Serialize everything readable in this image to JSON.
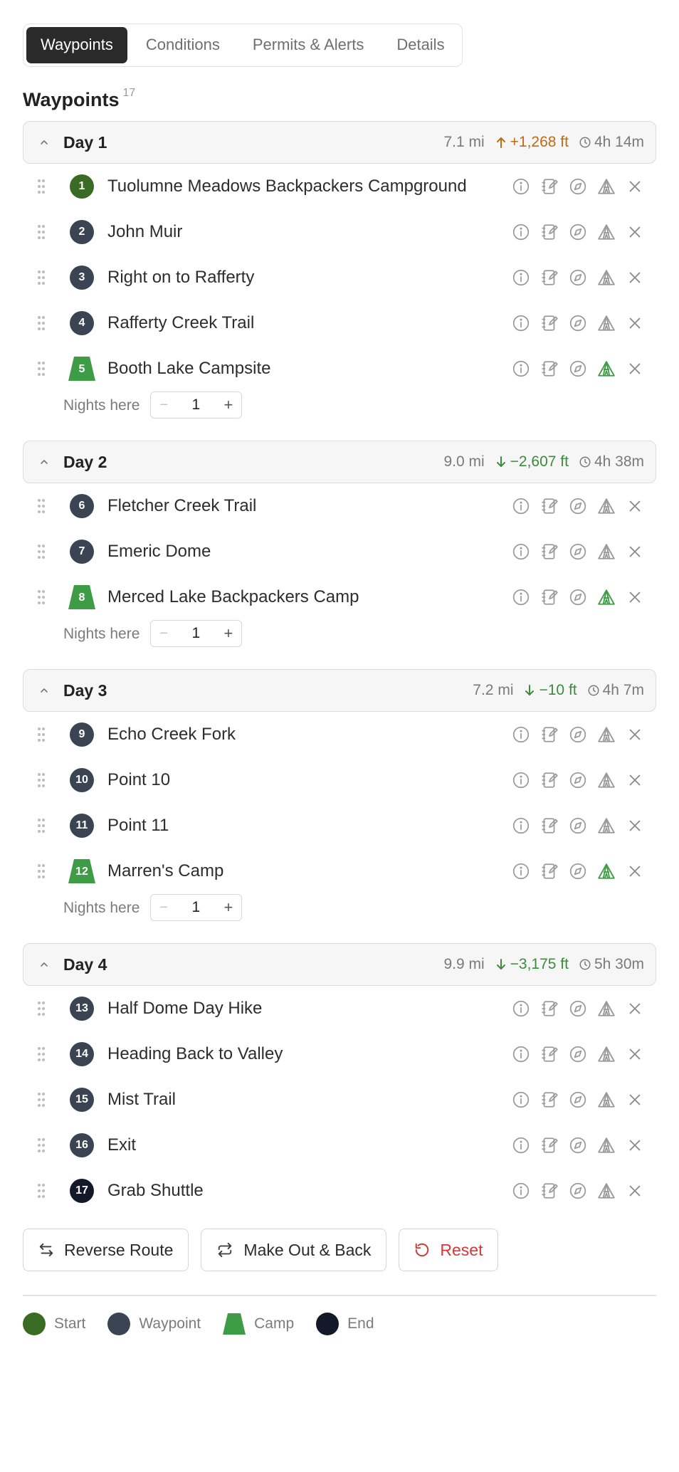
{
  "tabs": [
    {
      "label": "Waypoints",
      "active": true
    },
    {
      "label": "Conditions",
      "active": false
    },
    {
      "label": "Permits & Alerts",
      "active": false
    },
    {
      "label": "Details",
      "active": false
    }
  ],
  "section": {
    "title": "Waypoints",
    "count": "17"
  },
  "colors": {
    "start": "#3a6b23",
    "waypoint": "#3b4452",
    "camp": "#3e9c47",
    "end": "#14192a",
    "gain": "#c06a12",
    "loss": "#3d8b3d",
    "reset": "#d03a3a"
  },
  "nights_label": "Nights here",
  "days": [
    {
      "title": "Day 1",
      "distance": "7.1 mi",
      "elevation": "+1,268 ft",
      "direction": "up",
      "time": "4h 14m",
      "waypoints": [
        {
          "num": "1",
          "name": "Tuolumne Meadows Backpackers Campground",
          "type": "start"
        },
        {
          "num": "2",
          "name": "John Muir",
          "type": "waypoint"
        },
        {
          "num": "3",
          "name": "Right on to Rafferty",
          "type": "waypoint"
        },
        {
          "num": "4",
          "name": "Rafferty Creek Trail",
          "type": "waypoint"
        },
        {
          "num": "5",
          "name": "Booth Lake Campsite",
          "type": "camp",
          "nights": "1"
        }
      ]
    },
    {
      "title": "Day 2",
      "distance": "9.0 mi",
      "elevation": "−2,607 ft",
      "direction": "down",
      "time": "4h 38m",
      "waypoints": [
        {
          "num": "6",
          "name": "Fletcher Creek Trail",
          "type": "waypoint"
        },
        {
          "num": "7",
          "name": "Emeric Dome",
          "type": "waypoint"
        },
        {
          "num": "8",
          "name": "Merced Lake Backpackers Camp",
          "type": "camp",
          "nights": "1"
        }
      ]
    },
    {
      "title": "Day 3",
      "distance": "7.2 mi",
      "elevation": "−10 ft",
      "direction": "down",
      "time": "4h 7m",
      "waypoints": [
        {
          "num": "9",
          "name": "Echo Creek Fork",
          "type": "waypoint"
        },
        {
          "num": "10",
          "name": "Point 10",
          "type": "waypoint"
        },
        {
          "num": "11",
          "name": "Point 11",
          "type": "waypoint"
        },
        {
          "num": "12",
          "name": "Marren's Camp",
          "type": "camp",
          "nights": "1"
        }
      ]
    },
    {
      "title": "Day 4",
      "distance": "9.9 mi",
      "elevation": "−3,175 ft",
      "direction": "down",
      "time": "5h 30m",
      "waypoints": [
        {
          "num": "13",
          "name": "Half Dome Day Hike",
          "type": "waypoint"
        },
        {
          "num": "14",
          "name": "Heading Back to Valley",
          "type": "waypoint"
        },
        {
          "num": "15",
          "name": "Mist Trail",
          "type": "waypoint"
        },
        {
          "num": "16",
          "name": "Exit",
          "type": "waypoint"
        },
        {
          "num": "17",
          "name": "Grab Shuttle",
          "type": "end"
        }
      ]
    }
  ],
  "buttons": {
    "reverse": "Reverse Route",
    "out_back": "Make Out & Back",
    "reset": "Reset"
  },
  "legend": [
    {
      "label": "Start",
      "type": "start"
    },
    {
      "label": "Waypoint",
      "type": "waypoint"
    },
    {
      "label": "Camp",
      "type": "camp"
    },
    {
      "label": "End",
      "type": "end"
    }
  ]
}
